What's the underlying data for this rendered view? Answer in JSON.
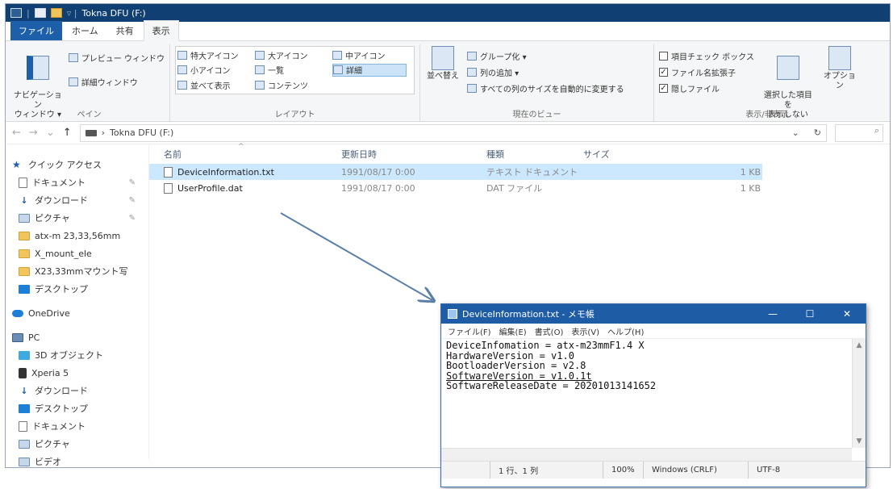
{
  "explorer": {
    "title": "Tokna DFU (F:)",
    "tabs": [
      "ファイル",
      "ホーム",
      "共有",
      "表示"
    ],
    "ribbon": {
      "pane_group": {
        "label": "ペイン",
        "nav_pane": "ナビゲーション\nウィンドウ ▾",
        "preview": "プレビュー ウィンドウ",
        "details": "詳細ウィンドウ"
      },
      "layout_group": {
        "label": "レイアウト",
        "items": [
          "特大アイコン",
          "大アイコン",
          "中アイコン",
          "小アイコン",
          "一覧",
          "詳細",
          "並べて表示",
          "コンテンツ"
        ],
        "selected": "詳細"
      },
      "current_view_group": {
        "label": "現在のビュー",
        "sort": "並べ替え",
        "group_by": "グループ化 ▾",
        "add_columns": "列の追加 ▾",
        "fit_columns": "すべての列のサイズを自動的に変更する"
      },
      "show_hide_group": {
        "label": "表示/非表示",
        "item_checkbox": "項目チェック ボックス",
        "extensions": "ファイル名拡張子",
        "hidden_items": "隠しファイル",
        "hide_selected": "選択した項目を\n表示しない",
        "options": "オプション"
      }
    },
    "address": {
      "path": "Tokna DFU (F:)",
      "breadcrumb_sep": "›",
      "dropdown": "⌄",
      "refresh": "↻",
      "search_icon": "⌕"
    },
    "nav": {
      "quick_access": "クイック アクセス",
      "items": [
        {
          "label": "ドキュメント",
          "icon": "document-icon",
          "pinned": true
        },
        {
          "label": "ダウンロード",
          "icon": "download-icon",
          "pinned": true
        },
        {
          "label": "ピクチャ",
          "icon": "pictures-icon",
          "pinned": true
        },
        {
          "label": "atx-m 23,33,56mm",
          "icon": "folder-icon",
          "pinned": false
        },
        {
          "label": "X_mount_ele",
          "icon": "folder-icon",
          "pinned": false
        },
        {
          "label": "X23,33mmマウント写",
          "icon": "folder-icon",
          "pinned": false
        },
        {
          "label": "デスクトップ",
          "icon": "desktop-icon",
          "pinned": false
        }
      ],
      "onedrive": "OneDrive",
      "pc": "PC",
      "pc_items": [
        {
          "label": "3D オブジェクト",
          "icon": "3d-objects-icon"
        },
        {
          "label": "Xperia 5",
          "icon": "phone-icon"
        },
        {
          "label": "ダウンロード",
          "icon": "download-icon"
        },
        {
          "label": "デスクトップ",
          "icon": "desktop-icon"
        },
        {
          "label": "ドキュメント",
          "icon": "document-icon"
        },
        {
          "label": "ピクチャ",
          "icon": "pictures-icon"
        },
        {
          "label": "ビデオ",
          "icon": "video-icon"
        }
      ]
    },
    "columns": [
      "名前",
      "更新日時",
      "種類",
      "サイズ"
    ],
    "files": [
      {
        "name": "DeviceInformation.txt",
        "date": "1991/08/17 0:00",
        "type": "テキスト ドキュメント",
        "size": "1 KB",
        "selected": true
      },
      {
        "name": "UserProfile.dat",
        "date": "1991/08/17 0:00",
        "type": "DAT ファイル",
        "size": "1 KB",
        "selected": false
      }
    ]
  },
  "notepad": {
    "title": "DeviceInformation.txt - メモ帳",
    "controls": [
      "—",
      "☐",
      "✕"
    ],
    "menu": [
      "ファイル(F)",
      "編集(E)",
      "書式(O)",
      "表示(V)",
      "ヘルプ(H)"
    ],
    "lines": [
      "DeviceInfomation = atx-m23mmF1.4 X",
      "HardwareVersion = v1.0",
      "BootloaderVersion = v2.8",
      "SoftwareVersion = v1.0.1t",
      "SoftwareReleaseDate = 20201013141652"
    ],
    "status": {
      "position": "1 行、1 列",
      "zoom": "100%",
      "eol": "Windows (CRLF)",
      "encoding": "UTF-8"
    }
  },
  "colors": {
    "explorer_title": "#0f3f73",
    "notepad_title": "#1e5da6",
    "selection": "#cce8ff",
    "arrow": "#5b7fa8"
  }
}
